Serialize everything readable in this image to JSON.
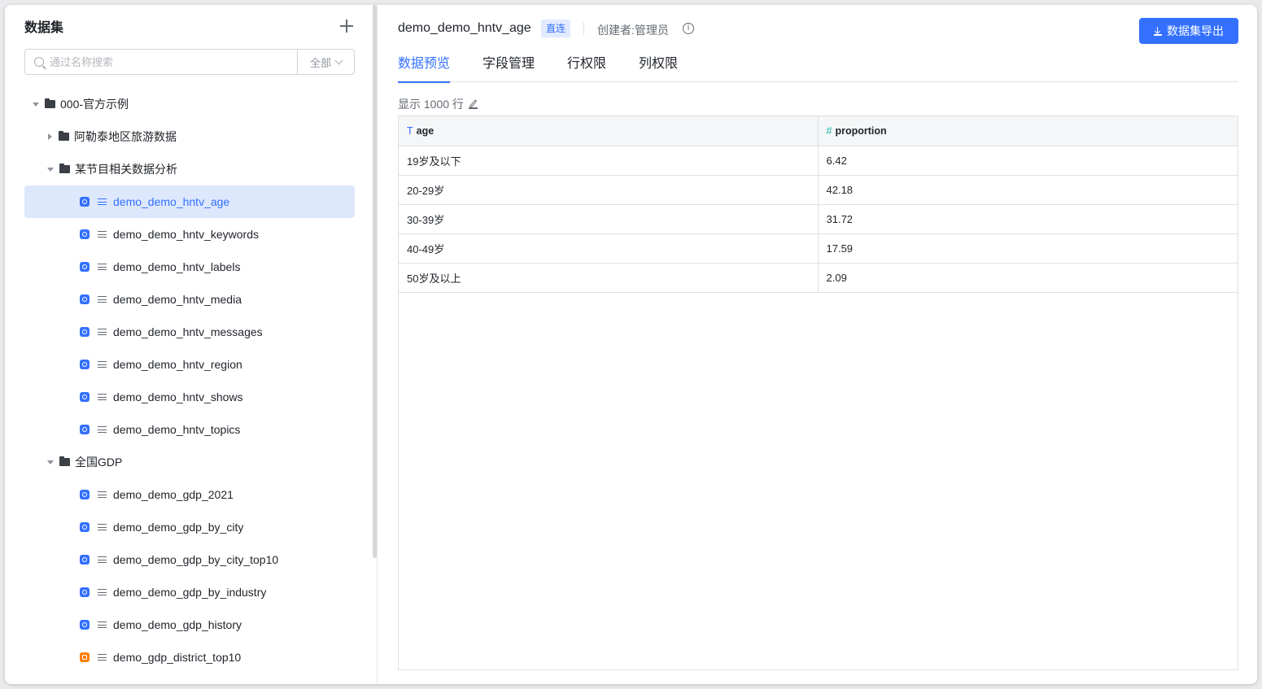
{
  "sidebar": {
    "title": "数据集",
    "search_placeholder": "通过名称搜索",
    "filter_label": "全部",
    "tree": {
      "root": "000-官方示例",
      "folder_travel": "阿勒泰地区旅游数据",
      "folder_program": "某节目相关数据分析",
      "program_items": [
        "demo_demo_hntv_age",
        "demo_demo_hntv_keywords",
        "demo_demo_hntv_labels",
        "demo_demo_hntv_media",
        "demo_demo_hntv_messages",
        "demo_demo_hntv_region",
        "demo_demo_hntv_shows",
        "demo_demo_hntv_topics"
      ],
      "folder_gdp": "全国GDP",
      "gdp_items": [
        "demo_demo_gdp_2021",
        "demo_demo_gdp_by_city",
        "demo_demo_gdp_by_city_top10",
        "demo_demo_gdp_by_industry",
        "demo_demo_gdp_history",
        "demo_gdp_district_top10"
      ]
    }
  },
  "main": {
    "dataset_name": "demo_demo_hntv_age",
    "badge": "直连",
    "creator": "创建者:管理员",
    "export_label": "数据集导出",
    "tabs": [
      "数据预览",
      "字段管理",
      "行权限",
      "列权限"
    ],
    "rows_info": "显示 1000 行",
    "table": {
      "columns": [
        {
          "type_icon": "T",
          "name": "age"
        },
        {
          "type_icon": "#",
          "name": "proportion"
        }
      ],
      "rows": [
        [
          "19岁及以下",
          "6.42"
        ],
        [
          "20-29岁",
          "42.18"
        ],
        [
          "30-39岁",
          "31.72"
        ],
        [
          "40-49岁",
          "17.59"
        ],
        [
          "50岁及以上",
          "2.09"
        ]
      ]
    }
  },
  "colors": {
    "accent": "#3370ff",
    "active_bg": "#dde8fd"
  }
}
